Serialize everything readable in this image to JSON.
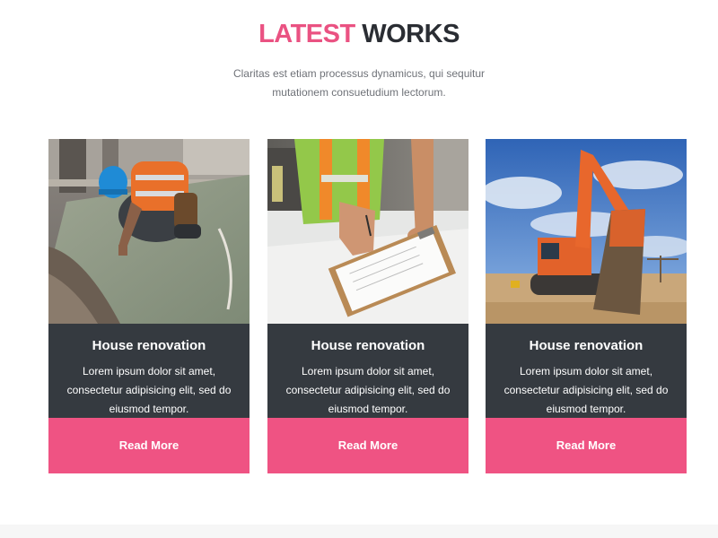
{
  "heading": {
    "accent": "LATEST",
    "rest": "WORKS",
    "accent_color": "#ea5282"
  },
  "subtitle": "Claritas est etiam processus dynamicus, qui sequitur mutationem consuetudium lectorum.",
  "cards": [
    {
      "image": "construction-worker-photo",
      "title": "House renovation",
      "text": "Lorem ipsum dolor sit amet, consectetur adipisicing elit, sed do eiusmod tempor.",
      "button": "Read More"
    },
    {
      "image": "clipboard-writing-photo",
      "title": "House renovation",
      "text": "Lorem ipsum dolor sit amet, consectetur adipisicing elit, sed do eiusmod tempor.",
      "button": "Read More"
    },
    {
      "image": "excavator-photo",
      "title": "House renovation",
      "text": "Lorem ipsum dolor sit amet, consectetur adipisicing elit, sed do eiusmod tempor.",
      "button": "Read More"
    }
  ],
  "colors": {
    "card_background": "#353a40",
    "button_background": "#ef5383"
  }
}
